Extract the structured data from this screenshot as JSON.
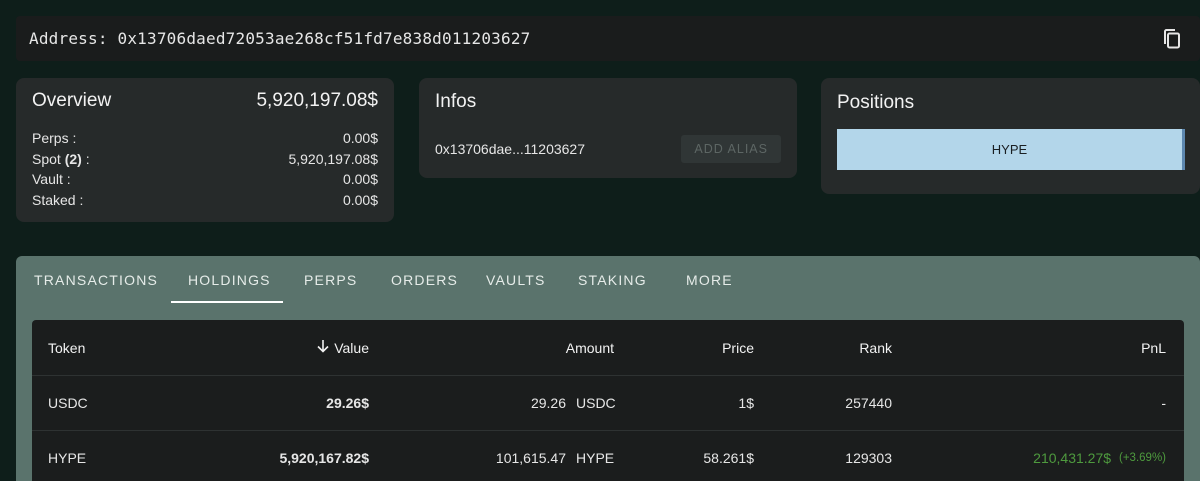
{
  "address": {
    "label": "Address:",
    "value": "0x13706daed72053ae268cf51fd7e838d011203627"
  },
  "overview": {
    "title": "Overview",
    "total": "5,920,197.08$",
    "rows": [
      {
        "label": "Perps :",
        "value": "0.00$"
      },
      {
        "label_prefix": "Spot ",
        "label_bold": "(2)",
        "label_suffix": " :",
        "value": "5,920,197.08$"
      },
      {
        "label": "Vault :",
        "value": "0.00$"
      },
      {
        "label": "Staked :",
        "value": "0.00$"
      }
    ]
  },
  "infos": {
    "title": "Infos",
    "short_address": "0x13706dae...11203627",
    "add_alias_label": "ADD ALIAS"
  },
  "positions": {
    "title": "Positions",
    "items": [
      {
        "label": "HYPE",
        "share": 1.0
      }
    ],
    "bar_color": "#b3d6ea"
  },
  "tabs": {
    "items": [
      "TRANSACTIONS",
      "HOLDINGS",
      "PERPS",
      "ORDERS",
      "VAULTS",
      "STAKING",
      "MORE"
    ],
    "active": "HOLDINGS"
  },
  "holdings": {
    "columns": [
      "Token",
      "Value",
      "Amount",
      "Price",
      "Rank",
      "PnL"
    ],
    "sort_icon": "arrow-down-icon",
    "rows": [
      {
        "token": "USDC",
        "value": "29.26$",
        "amount": "29.26",
        "amount_unit": "USDC",
        "price": "1$",
        "rank": "257440",
        "pnl": "-",
        "pnl_pct": ""
      },
      {
        "token": "HYPE",
        "value": "5,920,167.82$",
        "amount": "101,615.47",
        "amount_unit": "HYPE",
        "price": "58.261$",
        "rank": "129303",
        "pnl": "210,431.27$",
        "pnl_pct": "(+3.69%)"
      }
    ]
  },
  "colors": {
    "background": "#0e1e1a",
    "card": "#262a2a",
    "tab_bar": "#5a736c",
    "pnl_positive": "#4e9a3e"
  }
}
